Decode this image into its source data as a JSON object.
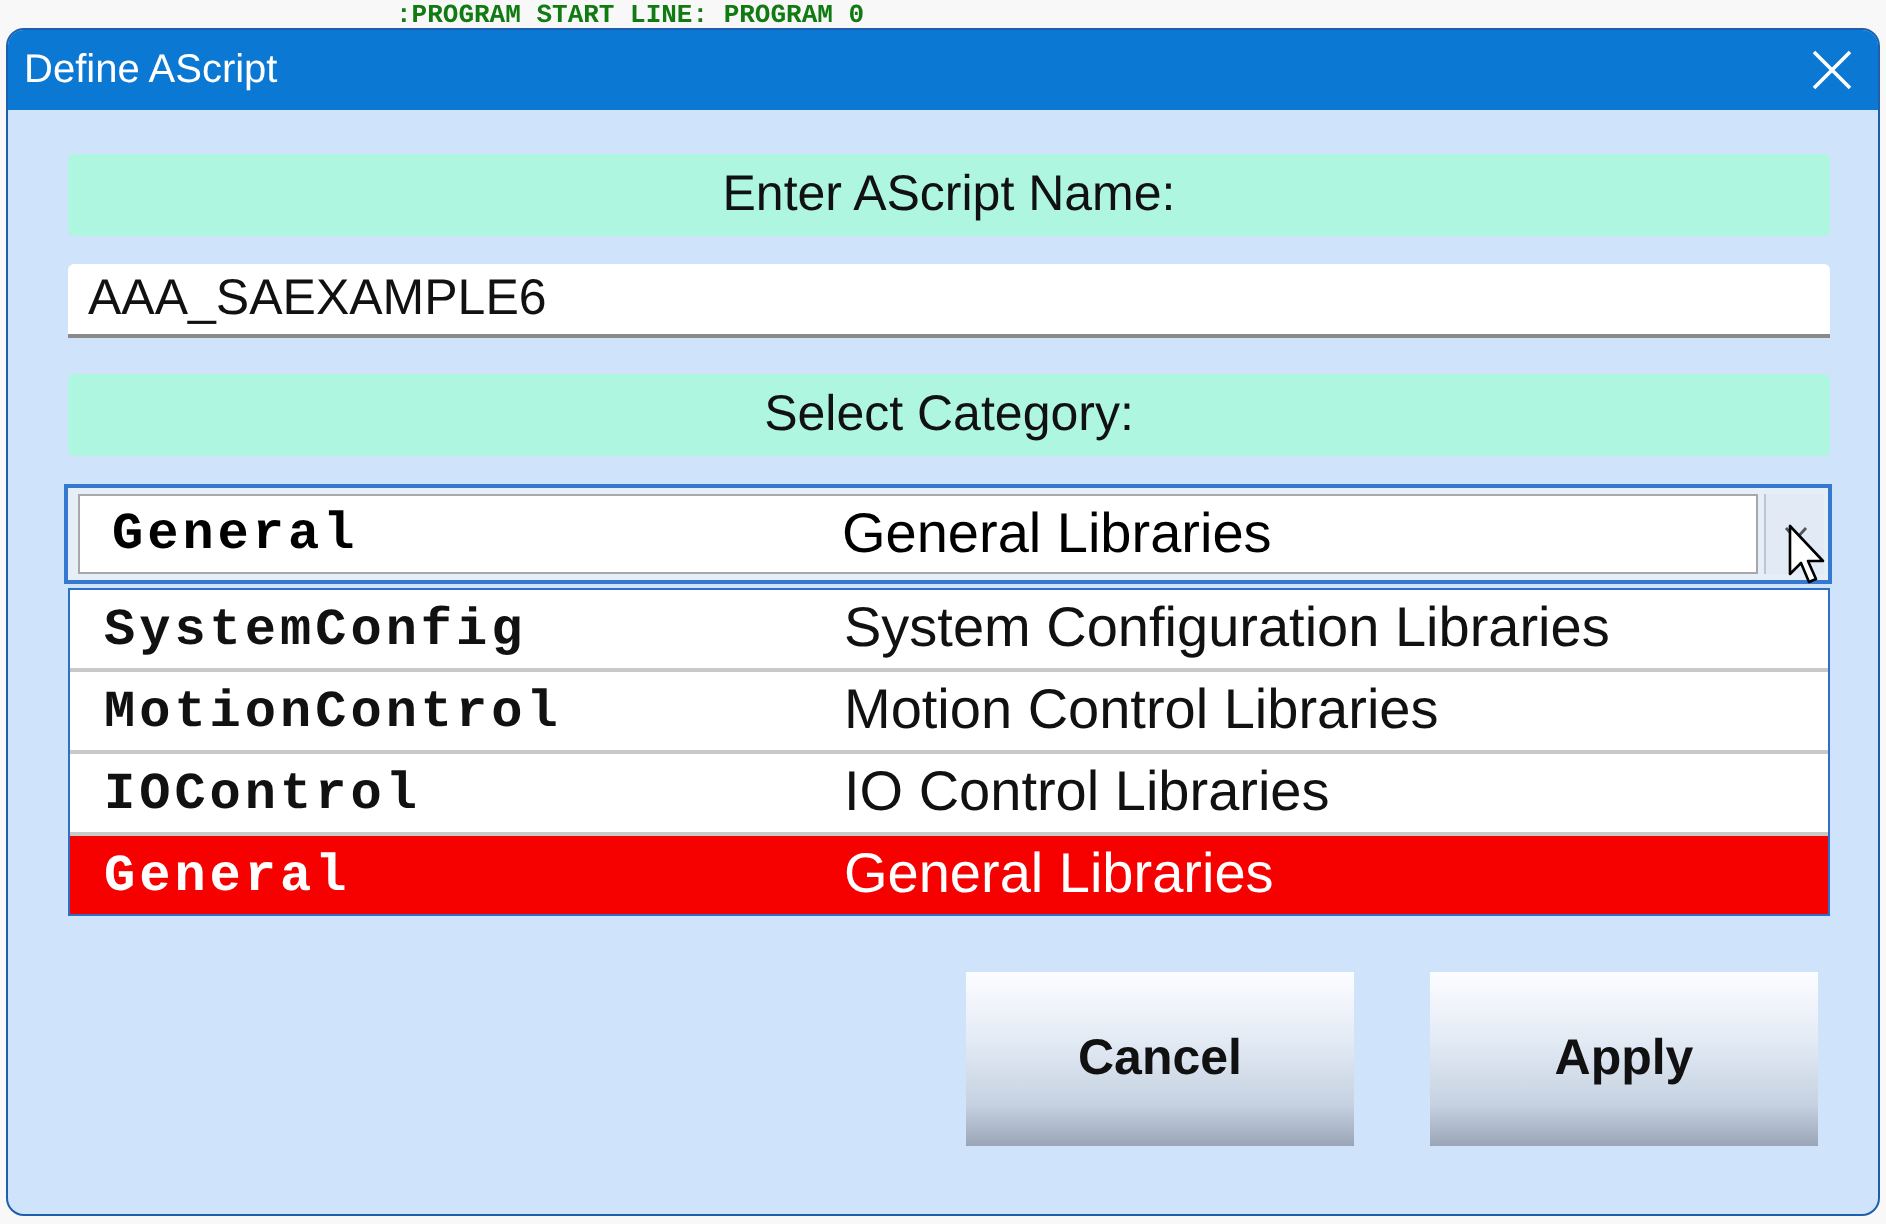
{
  "background_text": ":PROGRAM START LINE: PROGRAM 0",
  "window": {
    "title": "Define AScript"
  },
  "name_label": "Enter AScript Name:",
  "name_field": {
    "value": "AAA_SAEXAMPLE6"
  },
  "category_label": "Select Category:",
  "category_combo": {
    "code": "General",
    "description": "General Libraries",
    "expanded": true,
    "options": [
      {
        "code": "SystemConfig",
        "description": "System Configuration Libraries",
        "selected": false
      },
      {
        "code": "MotionControl",
        "description": "Motion Control Libraries",
        "selected": false
      },
      {
        "code": "IOControl",
        "description": "IO Control Libraries",
        "selected": false
      },
      {
        "code": "General",
        "description": "General Libraries",
        "selected": true
      }
    ]
  },
  "buttons": [
    {
      "label": "Cancel"
    },
    {
      "label": "Apply"
    }
  ]
}
